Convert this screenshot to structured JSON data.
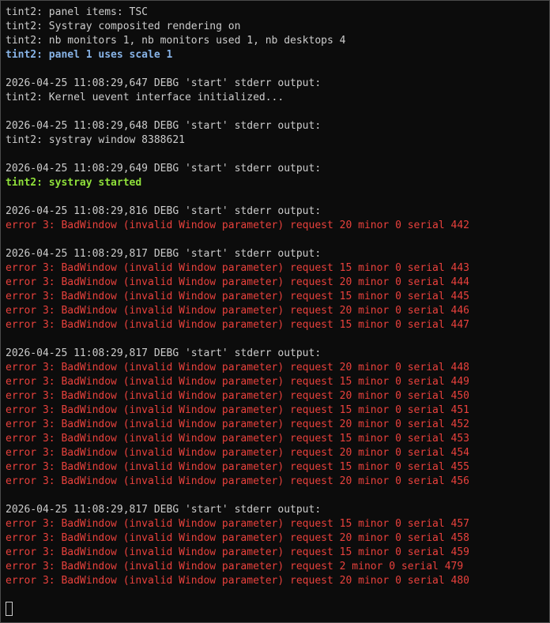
{
  "colors": {
    "background": "#0c0c0c",
    "normal": "#cccccc",
    "info": "#88b4e7",
    "success": "#8fe03a",
    "error": "#e8413c"
  },
  "lines": [
    {
      "text": "tint2: panel items: TSC",
      "kind": "normal"
    },
    {
      "text": "tint2: Systray composited rendering on",
      "kind": "normal"
    },
    {
      "text": "tint2: nb monitors 1, nb monitors used 1, nb desktops 4",
      "kind": "normal"
    },
    {
      "text": "tint2: panel 1 uses scale 1",
      "kind": "info"
    },
    {
      "text": "",
      "kind": "normal"
    },
    {
      "text": "2026-04-25 11:08:29,647 DEBG 'start' stderr output:",
      "kind": "normal"
    },
    {
      "text": "tint2: Kernel uevent interface initialized...",
      "kind": "normal"
    },
    {
      "text": "",
      "kind": "normal"
    },
    {
      "text": "2026-04-25 11:08:29,648 DEBG 'start' stderr output:",
      "kind": "normal"
    },
    {
      "text": "tint2: systray window 8388621",
      "kind": "normal"
    },
    {
      "text": "",
      "kind": "normal"
    },
    {
      "text": "2026-04-25 11:08:29,649 DEBG 'start' stderr output:",
      "kind": "normal"
    },
    {
      "text": "tint2: systray started",
      "kind": "success"
    },
    {
      "text": "",
      "kind": "normal"
    },
    {
      "text": "2026-04-25 11:08:29,816 DEBG 'start' stderr output:",
      "kind": "normal"
    },
    {
      "text": "error 3: BadWindow (invalid Window parameter) request 20 minor 0 serial 442",
      "kind": "error"
    },
    {
      "text": "",
      "kind": "normal"
    },
    {
      "text": "2026-04-25 11:08:29,817 DEBG 'start' stderr output:",
      "kind": "normal"
    },
    {
      "text": "error 3: BadWindow (invalid Window parameter) request 15 minor 0 serial 443",
      "kind": "error"
    },
    {
      "text": "error 3: BadWindow (invalid Window parameter) request 20 minor 0 serial 444",
      "kind": "error"
    },
    {
      "text": "error 3: BadWindow (invalid Window parameter) request 15 minor 0 serial 445",
      "kind": "error"
    },
    {
      "text": "error 3: BadWindow (invalid Window parameter) request 20 minor 0 serial 446",
      "kind": "error"
    },
    {
      "text": "error 3: BadWindow (invalid Window parameter) request 15 minor 0 serial 447",
      "kind": "error"
    },
    {
      "text": "",
      "kind": "normal"
    },
    {
      "text": "2026-04-25 11:08:29,817 DEBG 'start' stderr output:",
      "kind": "normal"
    },
    {
      "text": "error 3: BadWindow (invalid Window parameter) request 20 minor 0 serial 448",
      "kind": "error"
    },
    {
      "text": "error 3: BadWindow (invalid Window parameter) request 15 minor 0 serial 449",
      "kind": "error"
    },
    {
      "text": "error 3: BadWindow (invalid Window parameter) request 20 minor 0 serial 450",
      "kind": "error"
    },
    {
      "text": "error 3: BadWindow (invalid Window parameter) request 15 minor 0 serial 451",
      "kind": "error"
    },
    {
      "text": "error 3: BadWindow (invalid Window parameter) request 20 minor 0 serial 452",
      "kind": "error"
    },
    {
      "text": "error 3: BadWindow (invalid Window parameter) request 15 minor 0 serial 453",
      "kind": "error"
    },
    {
      "text": "error 3: BadWindow (invalid Window parameter) request 20 minor 0 serial 454",
      "kind": "error"
    },
    {
      "text": "error 3: BadWindow (invalid Window parameter) request 15 minor 0 serial 455",
      "kind": "error"
    },
    {
      "text": "error 3: BadWindow (invalid Window parameter) request 20 minor 0 serial 456",
      "kind": "error"
    },
    {
      "text": "",
      "kind": "normal"
    },
    {
      "text": "2026-04-25 11:08:29,817 DEBG 'start' stderr output:",
      "kind": "normal"
    },
    {
      "text": "error 3: BadWindow (invalid Window parameter) request 15 minor 0 serial 457",
      "kind": "error"
    },
    {
      "text": "error 3: BadWindow (invalid Window parameter) request 20 minor 0 serial 458",
      "kind": "error"
    },
    {
      "text": "error 3: BadWindow (invalid Window parameter) request 15 minor 0 serial 459",
      "kind": "error"
    },
    {
      "text": "error 3: BadWindow (invalid Window parameter) request 2 minor 0 serial 479",
      "kind": "error"
    },
    {
      "text": "error 3: BadWindow (invalid Window parameter) request 20 minor 0 serial 480",
      "kind": "error"
    }
  ]
}
